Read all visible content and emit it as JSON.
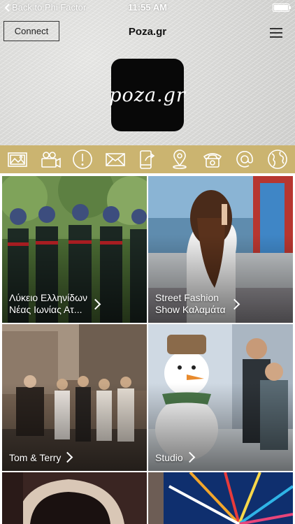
{
  "status_bar": {
    "back_label": "Back to Phi Factor",
    "time": "11:55 AM"
  },
  "header": {
    "connect_label": "Connect",
    "title": "Poza.gr",
    "logo_text": "poza.gr"
  },
  "icon_bar": {
    "background": "#cbb470",
    "icons": [
      "photo-gallery-icon",
      "video-camera-icon",
      "info-alert-icon",
      "mail-icon",
      "mobile-share-icon",
      "location-pin-icon",
      "phone-icon",
      "at-email-icon",
      "globe-icon"
    ]
  },
  "tiles": [
    {
      "line1": "Λύκειο Ελληνίδων",
      "line2": "Νέας Ιωνίας Ατ..."
    },
    {
      "line1": "Street Fashion",
      "line2": "Show Καλαμάτα"
    },
    {
      "line1": "Tom & Terry",
      "line2": ""
    },
    {
      "line1": "Studio",
      "line2": ""
    },
    {
      "line1": "",
      "line2": ""
    },
    {
      "line1": "",
      "line2": ""
    }
  ]
}
